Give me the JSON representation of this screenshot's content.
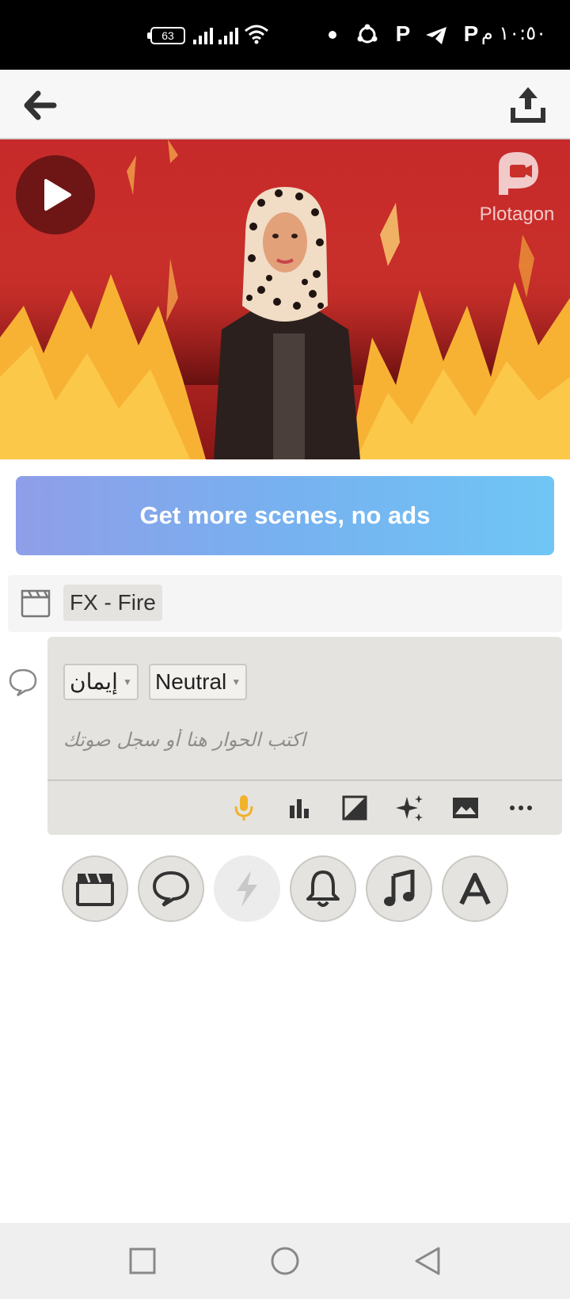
{
  "status_bar": {
    "time": "١٠:٥٠ م",
    "battery": "63"
  },
  "app_bar": {
    "back_icon": "arrow-left-icon",
    "share_icon": "share-tray-icon"
  },
  "preview": {
    "background": "fire",
    "watermark": "Plotagon"
  },
  "promo": {
    "label": "Get more scenes, no ads"
  },
  "scene": {
    "label": "FX - Fire"
  },
  "dialog": {
    "character": "إيمان",
    "mood": "Neutral",
    "placeholder": "اكتب الحوار هنا أو سجل صوتك",
    "tools": [
      "microphone-icon",
      "bar-chart-icon",
      "contrast-icon",
      "sparkle-icon",
      "image-icon",
      "more-icon"
    ]
  },
  "categories": [
    "scene-icon",
    "speech-bubble-icon",
    "lightning-icon",
    "bell-icon",
    "music-note-icon",
    "text-icon"
  ],
  "colors": {
    "accent_mic": "#f0b32b",
    "card_bg": "#e4e3df",
    "banner_start": "#8f9ee8",
    "banner_end": "#6fc6f5"
  }
}
